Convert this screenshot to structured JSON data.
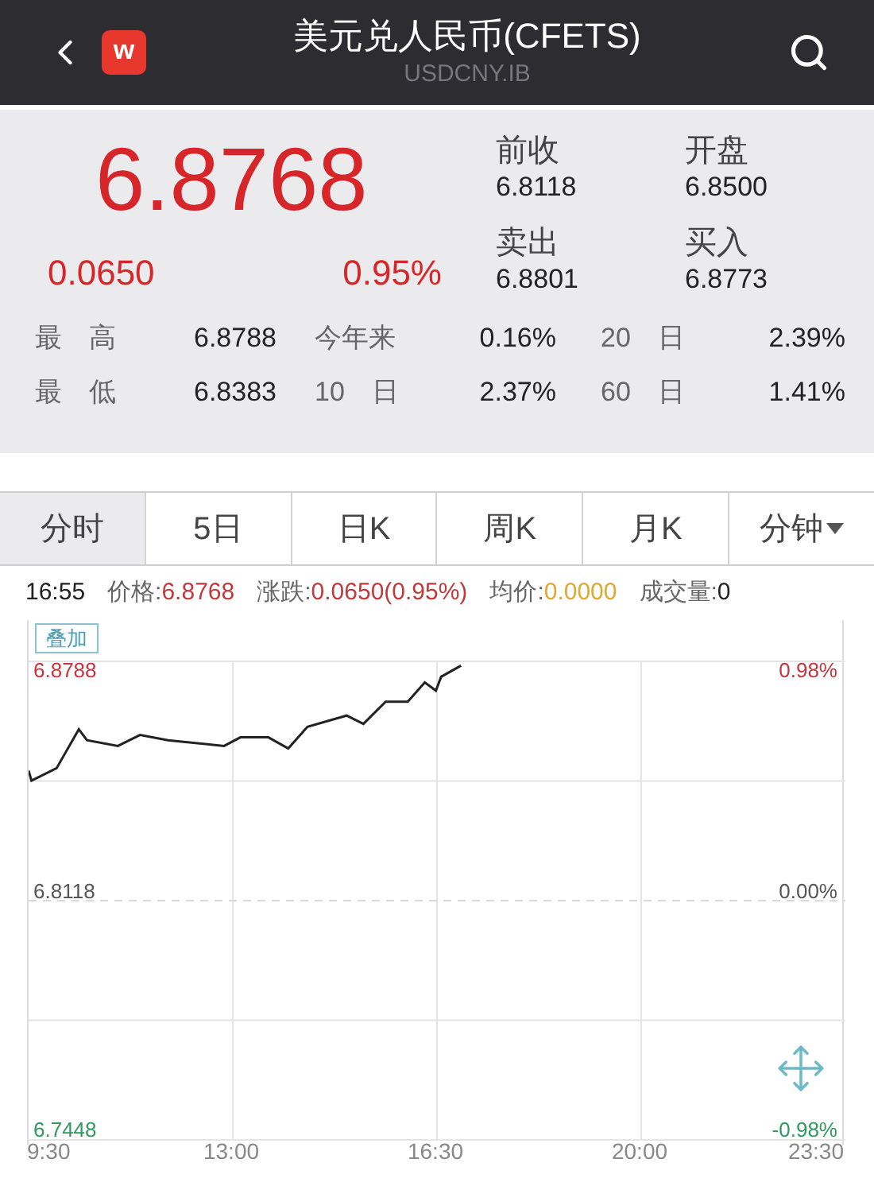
{
  "header": {
    "logo": "w",
    "title": "美元兑人民币(CFETS)",
    "subtitle": "USDCNY.IB"
  },
  "quote": {
    "price": "6.8768",
    "change": "0.0650",
    "change_pct": "0.95%",
    "fields": [
      {
        "label": "前收",
        "value": "6.8118"
      },
      {
        "label": "开盘",
        "value": "6.8500"
      },
      {
        "label": "卖出",
        "value": "6.8801"
      },
      {
        "label": "买入",
        "value": "6.8773"
      }
    ]
  },
  "stats": [
    [
      {
        "label": "最　高",
        "value": "6.8788"
      },
      {
        "label": "今年来",
        "value": "0.16%"
      },
      {
        "label": "20　日",
        "value": "2.39%"
      }
    ],
    [
      {
        "label": "最　低",
        "value": "6.8383"
      },
      {
        "label": "10　日",
        "value": "2.37%"
      },
      {
        "label": "60　日",
        "value": "1.41%"
      }
    ]
  ],
  "tabs": [
    {
      "label": "分时",
      "selected": true,
      "dropdown": false
    },
    {
      "label": "5日",
      "selected": false,
      "dropdown": false
    },
    {
      "label": "日K",
      "selected": false,
      "dropdown": false
    },
    {
      "label": "周K",
      "selected": false,
      "dropdown": false
    },
    {
      "label": "月K",
      "selected": false,
      "dropdown": false
    },
    {
      "label": "分钟",
      "selected": false,
      "dropdown": true
    }
  ],
  "info_bar": {
    "time": "16:55",
    "items": [
      {
        "label": "价格:",
        "value": "6.8768",
        "color": "#c0393b"
      },
      {
        "label": "涨跌:",
        "value": "0.0650(0.95%)",
        "color": "#c0393b"
      },
      {
        "label": "均价:",
        "value": "0.0000",
        "color": "#e0a82e"
      },
      {
        "label": "成交量:",
        "value": "0",
        "color": "#222222"
      }
    ]
  },
  "chart": {
    "overlay_button": "叠加",
    "right_labels": [
      {
        "label": "0.98%",
        "color": "#c9333b"
      },
      {
        "label": "0.00%",
        "color": "#555555"
      },
      {
        "label": "-0.98%",
        "color": "#2e9a5e"
      }
    ],
    "chart_data": {
      "type": "line",
      "x": [
        9.5,
        9.55,
        9.98,
        10.36,
        10.5,
        11.03,
        11.41,
        11.89,
        12.85,
        13.13,
        13.61,
        13.95,
        14.28,
        14.95,
        15.24,
        15.62,
        16.0,
        16.29,
        16.48,
        16.57,
        16.91
      ],
      "series": [
        {
          "color": "#222222",
          "values": [
            6.8482,
            6.8454,
            6.8489,
            6.8598,
            6.8567,
            6.8551,
            6.8582,
            6.8567,
            6.8551,
            6.8575,
            6.8575,
            6.8544,
            6.8605,
            6.8636,
            6.8613,
            6.8675,
            6.8675,
            6.8729,
            6.8706,
            6.8745,
            6.8776
          ]
        }
      ],
      "grid": true,
      "ref_lines": [
        {
          "axis": "y",
          "value": 6.8118
        }
      ],
      "xlim": [
        9.5,
        23.5
      ],
      "ylim": [
        6.7448,
        6.8788
      ],
      "xticks": [
        {
          "value": 9.5,
          "label": "9:30"
        },
        {
          "value": 13,
          "label": "13:00"
        },
        {
          "value": 16.5,
          "label": "16:30"
        },
        {
          "value": 20,
          "label": "20:00"
        },
        {
          "value": 23.5,
          "label": "23:30"
        }
      ],
      "yticks": [
        {
          "value": 6.8788,
          "label": "6.8788"
        },
        {
          "value": 6.8118,
          "label": "6.8118"
        },
        {
          "value": 6.7448,
          "label": "6.7448"
        }
      ]
    }
  }
}
